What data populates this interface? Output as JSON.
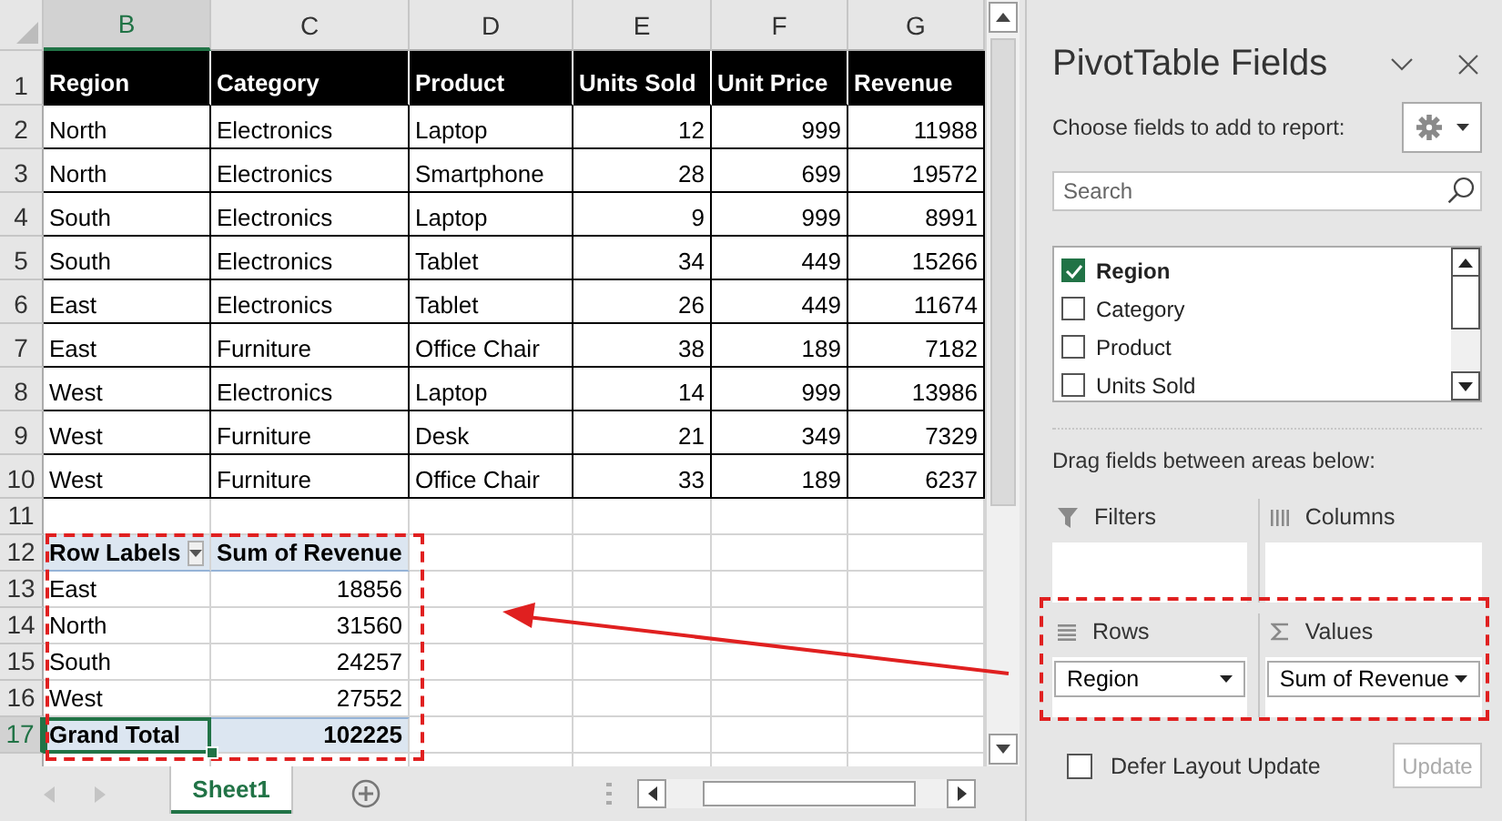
{
  "sheet": {
    "columns": [
      {
        "label": "B",
        "selected": true
      },
      {
        "label": "C",
        "selected": false
      },
      {
        "label": "D",
        "selected": false
      },
      {
        "label": "E",
        "selected": false
      },
      {
        "label": "F",
        "selected": false
      },
      {
        "label": "G",
        "selected": false
      }
    ],
    "rows": [
      {
        "number": "1",
        "kind": "header",
        "selected": false,
        "cells": [
          "Region",
          "Category",
          "Product",
          "Units Sold",
          "Unit Price",
          "Revenue"
        ]
      },
      {
        "number": "2",
        "kind": "data",
        "selected": false,
        "cells": [
          "North",
          "Electronics",
          "Laptop",
          "12",
          "999",
          "11988"
        ]
      },
      {
        "number": "3",
        "kind": "data",
        "selected": false,
        "cells": [
          "North",
          "Electronics",
          "Smartphone",
          "28",
          "699",
          "19572"
        ]
      },
      {
        "number": "4",
        "kind": "data",
        "selected": false,
        "cells": [
          "South",
          "Electronics",
          "Laptop",
          "9",
          "999",
          "8991"
        ]
      },
      {
        "number": "5",
        "kind": "data",
        "selected": false,
        "cells": [
          "South",
          "Electronics",
          "Tablet",
          "34",
          "449",
          "15266"
        ]
      },
      {
        "number": "6",
        "kind": "data",
        "selected": false,
        "cells": [
          "East",
          "Electronics",
          "Tablet",
          "26",
          "449",
          "11674"
        ]
      },
      {
        "number": "7",
        "kind": "data",
        "selected": false,
        "cells": [
          "East",
          "Furniture",
          "Office Chair",
          "38",
          "189",
          "7182"
        ]
      },
      {
        "number": "8",
        "kind": "data",
        "selected": false,
        "cells": [
          "West",
          "Electronics",
          "Laptop",
          "14",
          "999",
          "13986"
        ]
      },
      {
        "number": "9",
        "kind": "data",
        "selected": false,
        "cells": [
          "West",
          "Furniture",
          "Desk",
          "21",
          "349",
          "7329"
        ]
      },
      {
        "number": "10",
        "kind": "data",
        "selected": false,
        "cells": [
          "West",
          "Furniture",
          "Office Chair",
          "33",
          "189",
          "6237"
        ]
      },
      {
        "number": "11",
        "kind": "empty",
        "selected": false
      },
      {
        "number": "12",
        "kind": "pivot-header",
        "selected": false,
        "cells": [
          "Row Labels",
          "Sum of Revenue"
        ]
      },
      {
        "number": "13",
        "kind": "pivot",
        "selected": false,
        "cells": [
          "East",
          "18856"
        ]
      },
      {
        "number": "14",
        "kind": "pivot",
        "selected": false,
        "cells": [
          "North",
          "31560"
        ]
      },
      {
        "number": "15",
        "kind": "pivot",
        "selected": false,
        "cells": [
          "South",
          "24257"
        ]
      },
      {
        "number": "16",
        "kind": "pivot",
        "selected": false,
        "cells": [
          "West",
          "27552"
        ]
      },
      {
        "number": "17",
        "kind": "pivot-total",
        "selected": true,
        "cells": [
          "Grand Total",
          "102225"
        ]
      }
    ]
  },
  "sheet_tabs": [
    {
      "label": "Sheet1",
      "selected": true
    }
  ],
  "pivot_panel": {
    "title": "PivotTable Fields",
    "subtitle": "Choose fields to add to report:",
    "search": {
      "placeholder": "Search"
    },
    "fields": [
      {
        "label": "Region",
        "checked": true
      },
      {
        "label": "Category",
        "checked": false
      },
      {
        "label": "Product",
        "checked": false
      },
      {
        "label": "Units Sold",
        "checked": false
      }
    ],
    "areas_hint": "Drag fields between areas below:",
    "areas": [
      {
        "kind": "filters",
        "label": "Filters"
      },
      {
        "kind": "columns",
        "label": "Columns"
      },
      {
        "kind": "rows",
        "label": "Rows",
        "items": [
          "Region"
        ]
      },
      {
        "kind": "values",
        "label": "Values",
        "items": [
          "Sum of Revenue"
        ]
      }
    ],
    "defer": {
      "label": "Defer Layout Update",
      "checked": false
    },
    "update_button": {
      "label": "Update",
      "disabled": true
    }
  }
}
